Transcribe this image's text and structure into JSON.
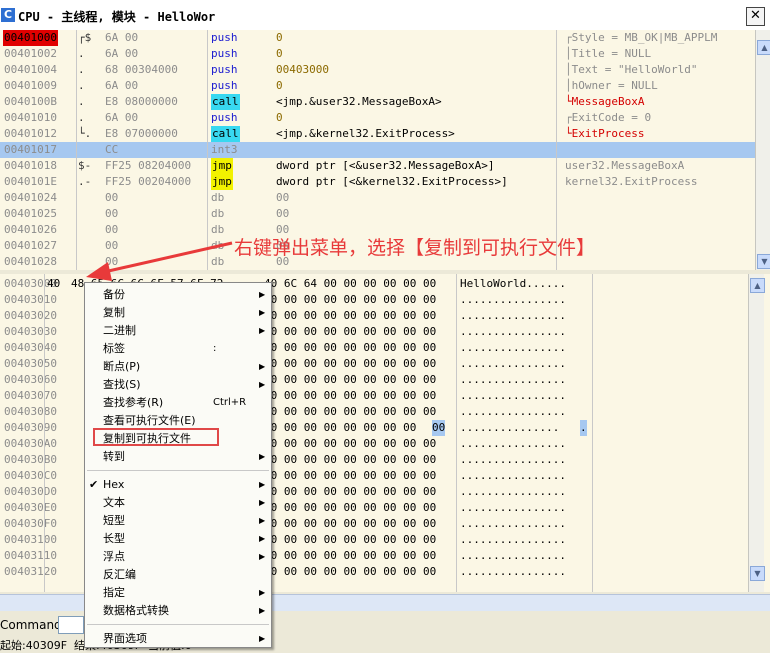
{
  "window": {
    "icon_letter": "C",
    "title": "CPU - 主线程, 模块 - HelloWor",
    "close_glyph": "✕"
  },
  "disasm": {
    "rows": [
      {
        "addr": "00401000",
        "br": "┌$",
        "hex": "6A 00",
        "mn": "push",
        "op": "0",
        "cm": "┌Style = MB_OK|MB_APPLM",
        "current": true
      },
      {
        "addr": "00401002",
        "br": ".",
        "hex": "6A 00",
        "mn": "push",
        "op": "0",
        "cm": "│Title = NULL"
      },
      {
        "addr": "00401004",
        "br": ".",
        "hex": "68 00304000",
        "mn": "push",
        "op": "00403000",
        "cm": "│Text = \"HelloWorld\""
      },
      {
        "addr": "00401009",
        "br": ".",
        "hex": "6A 00",
        "mn": "push",
        "op": "0",
        "cm": "│hOwner = NULL"
      },
      {
        "addr": "0040100B",
        "br": ".",
        "hex": "E8 08000000",
        "mn": "call",
        "op": "<jmp.&user32.MessageBoxA>",
        "cm": "└MessageBoxA"
      },
      {
        "addr": "00401010",
        "br": ".",
        "hex": "6A 00",
        "mn": "push",
        "op": "0",
        "cm": "┌ExitCode = 0"
      },
      {
        "addr": "00401012",
        "br": "└.",
        "hex": "E8 07000000",
        "mn": "call",
        "op": "<jmp.&kernel32.ExitProcess>",
        "cm": "└ExitProcess"
      },
      {
        "addr": "00401017",
        "br": "",
        "hex": "CC",
        "mn": "int3",
        "op": "",
        "cm": "",
        "selected": true
      },
      {
        "addr": "00401018",
        "br": "$-",
        "hex": "FF25 08204000",
        "mn": "jmp",
        "op": "dword ptr [<&user32.MessageBoxA>]",
        "cm": "user32.MessageBoxA"
      },
      {
        "addr": "0040101E",
        "br": ".-",
        "hex": "FF25 00204000",
        "mn": "jmp",
        "op": "dword ptr [<&kernel32.ExitProcess>]",
        "cm": "kernel32.ExitProcess"
      },
      {
        "addr": "00401024",
        "br": "",
        "hex": "00",
        "mn": "db",
        "op": "00",
        "cm": ""
      },
      {
        "addr": "00401025",
        "br": "",
        "hex": "00",
        "mn": "db",
        "op": "00",
        "cm": ""
      },
      {
        "addr": "00401026",
        "br": "",
        "hex": "00",
        "mn": "db",
        "op": "00",
        "cm": ""
      },
      {
        "addr": "00401027",
        "br": "",
        "hex": "00",
        "mn": "db",
        "op": "00",
        "cm": ""
      },
      {
        "addr": "00401028",
        "br": "",
        "hex": "00",
        "mn": "db",
        "op": "00",
        "cm": ""
      }
    ]
  },
  "dump": {
    "first_row_bytes": "40 6C 64 00 00 00 00 00 00",
    "first_row_prefix": "40",
    "first_row_hidden_mid": "48 65 6C 6C 6F 57 6F 72",
    "first_row_ascii": "HelloWorld......",
    "zero_bytes": "00 00 00 00 00 00 00 00 00",
    "zero_ascii": "................",
    "row9_bytes": "00 00 00 00 00 00 00 00",
    "row9_sel_byte": "00",
    "row9_ascii": "...............",
    "row9_sel_ascii": ".",
    "addresses": [
      "00403000",
      "00403010",
      "00403020",
      "00403030",
      "00403040",
      "00403050",
      "00403060",
      "00403070",
      "00403080",
      "00403090",
      "004030A0",
      "004030B0",
      "004030C0",
      "004030D0",
      "004030E0",
      "004030F0",
      "00403100",
      "00403110",
      "00403120"
    ]
  },
  "annotation": "右键弹出菜单，选择【复制到可执行文件】",
  "context_menu": {
    "items": [
      {
        "label": "备份",
        "sub": true
      },
      {
        "label": "复制",
        "sub": true
      },
      {
        "label": "二进制",
        "sub": true
      },
      {
        "label": "标签",
        "short": ":"
      },
      {
        "label": "断点(P)",
        "sub": true
      },
      {
        "label": "查找(S)",
        "sub": true
      },
      {
        "label": "查找参考(R)",
        "short": "Ctrl+R"
      },
      {
        "label": "查看可执行文件(E)"
      },
      {
        "label": "复制到可执行文件",
        "highlighted": true
      },
      {
        "label": "转到",
        "sub": true
      },
      {
        "label": "Hex",
        "sub": true,
        "checked": true,
        "sep_before": true
      },
      {
        "label": "文本",
        "sub": true
      },
      {
        "label": "短型",
        "sub": true
      },
      {
        "label": "长型",
        "sub": true
      },
      {
        "label": "浮点",
        "sub": true
      },
      {
        "label": "反汇编"
      },
      {
        "label": "指定",
        "sub": true
      },
      {
        "label": "数据格式转换",
        "sub": true
      },
      {
        "label": "界面选项",
        "sub": true,
        "sep_before": true
      }
    ],
    "submenu_glyph": "▶",
    "check_glyph": "✔"
  },
  "command": {
    "label": "Command"
  },
  "status": {
    "text": "起始:40309F  结束:40309F  当前值:0"
  }
}
